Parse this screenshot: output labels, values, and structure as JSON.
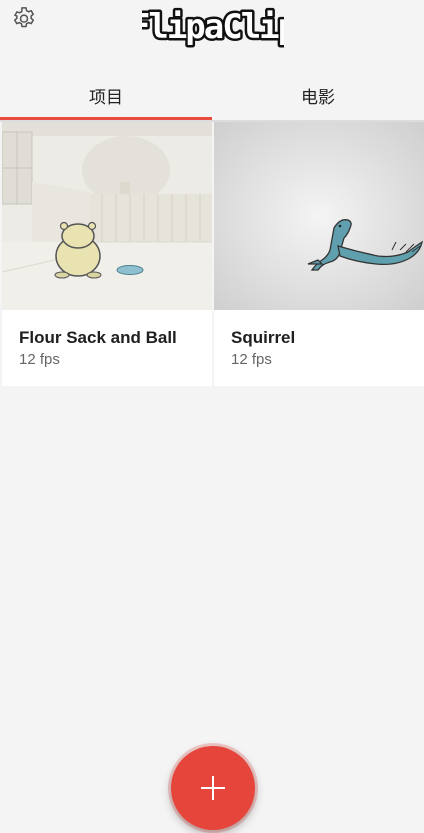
{
  "header": {
    "logo_text": "FlipaClip",
    "settings_icon": "gear-icon"
  },
  "tabs": [
    {
      "label": "项目",
      "active": true
    },
    {
      "label": "电影",
      "active": false
    }
  ],
  "projects": [
    {
      "title": "Flour Sack and Ball",
      "subtitle": "12 fps",
      "thumb": "hamster-and-ball-scene"
    },
    {
      "title": "Squirrel",
      "subtitle": "12 fps",
      "thumb": "squirrel-scene"
    }
  ],
  "fab": {
    "icon": "plus-icon"
  },
  "colors": {
    "accent": "#e94b3c",
    "background": "#f4f4f4",
    "card": "#ffffff",
    "fab": "#e5453a"
  }
}
